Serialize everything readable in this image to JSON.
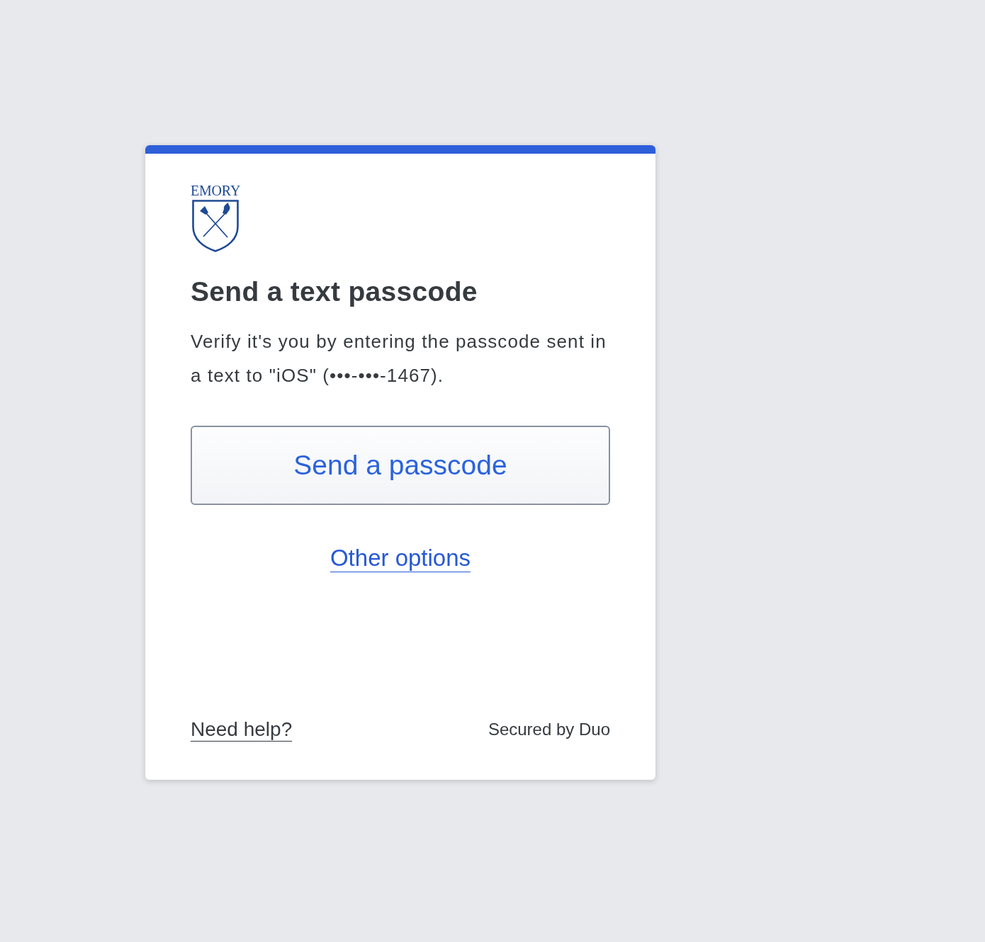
{
  "logo": {
    "wordmark": "EMORY"
  },
  "heading": "Send a text passcode",
  "description": "Verify it's you by entering the passcode sent in a text to \"iOS\" (•••-•••-1467).",
  "primary_button": {
    "label": "Send a passcode"
  },
  "other_options_link": {
    "label": "Other options"
  },
  "footer": {
    "help_link": "Need help?",
    "secured_by": "Secured by Duo"
  }
}
